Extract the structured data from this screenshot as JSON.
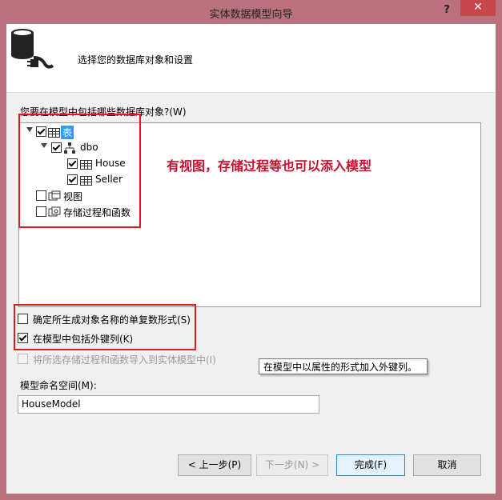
{
  "window": {
    "title": "实体数据模型向导",
    "help_label": "?",
    "close_label": "✕"
  },
  "header": {
    "text": "选择您的数据库对象和设置"
  },
  "tree": {
    "question": "您要在模型中包括哪些数据库对象?(W)",
    "tables_label": "表",
    "schema_label": "dbo",
    "table1": "House",
    "table2": "Seller",
    "views_label": "视图",
    "procs_label": "存储过程和函数"
  },
  "annotation": "有视图，存储过程等也可以添入模型",
  "options": {
    "pluralize": "确定所生成对象名称的单复数形式(S)",
    "foreign_keys": "在模型中包括外键列(K)",
    "import_procs": "将所选存储过程和函数导入到实体模型中(I)"
  },
  "tooltip": "在模型中以属性的形式加入外键列。",
  "namespace": {
    "label": "模型命名空间(M):",
    "value": "HouseModel"
  },
  "buttons": {
    "prev": "< 上一步(P)",
    "next": "下一步(N) >",
    "finish": "完成(F)",
    "cancel": "取消"
  },
  "colors": {
    "frame": "#b8717d",
    "annotation": "#c8102e",
    "highlight_box": "#e0191b",
    "selection": "#3399ff"
  }
}
